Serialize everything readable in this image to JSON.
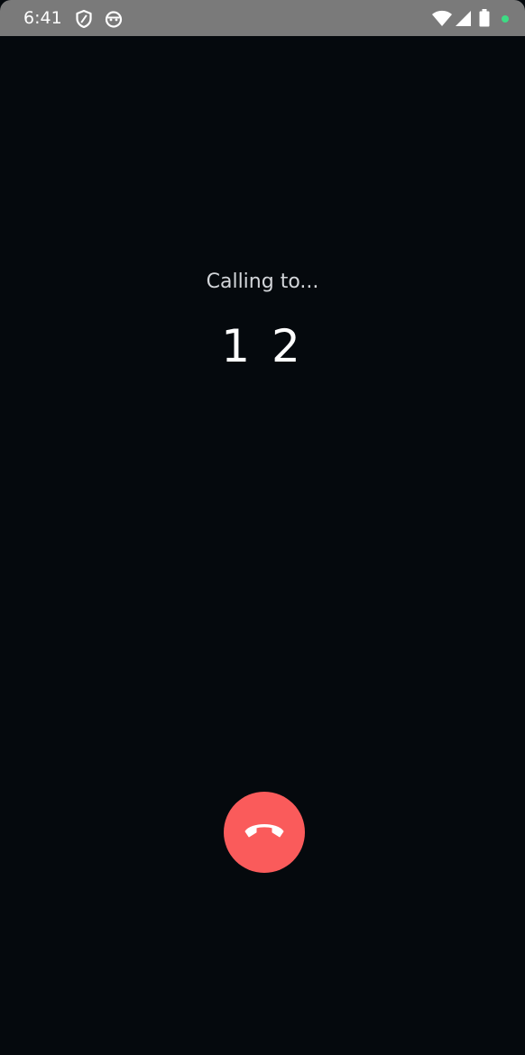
{
  "status_bar": {
    "time": "6:41",
    "left_icons": [
      "shield-icon",
      "android-bot-icon"
    ],
    "right_icons": [
      "wifi-icon",
      "cell-signal-icon",
      "battery-icon",
      "privacy-dot-icon"
    ],
    "privacy_dot_color": "#3ddc84"
  },
  "call": {
    "caption": "Calling to...",
    "number": "1 2"
  },
  "end_call_button": {
    "icon": "end-call-icon",
    "color": "#fa5b5b"
  },
  "colors": {
    "background": "#05090d",
    "status_bar": "#7a7a7a"
  }
}
